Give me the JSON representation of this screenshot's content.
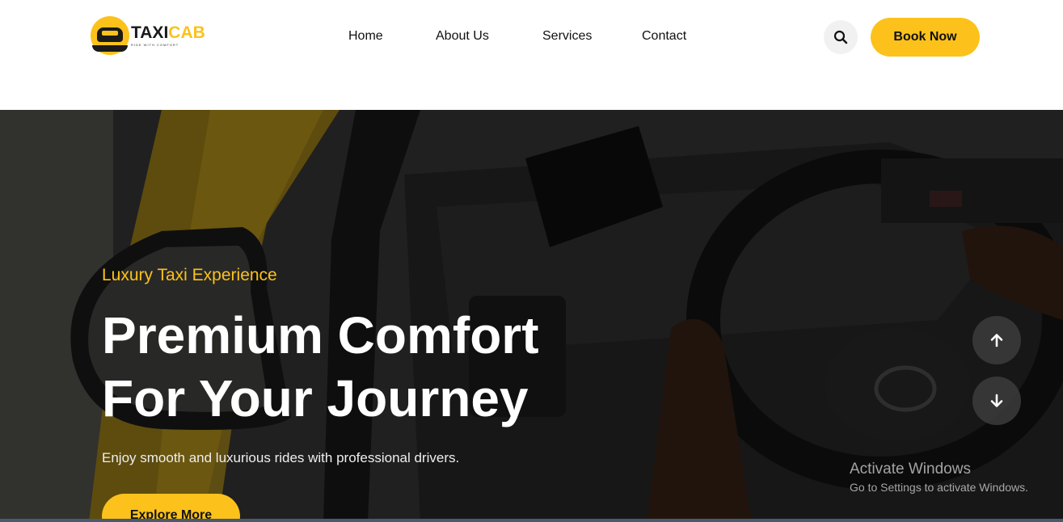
{
  "header": {
    "logo": {
      "taxi": "TAXI",
      "cab": "CAB",
      "tagline": "RIDE WITH COMFORT"
    },
    "nav": [
      {
        "label": "Home"
      },
      {
        "label": "About Us"
      },
      {
        "label": "Services"
      },
      {
        "label": "Contact"
      }
    ],
    "search_icon": "search-icon",
    "book_label": "Book Now"
  },
  "hero": {
    "subtitle": "Luxury Taxi Experience",
    "title_line1": "Premium Comfort",
    "title_line2": "For Your Journey",
    "description": "Enjoy smooth and luxurious rides with professional drivers.",
    "cta_label": "Explore More",
    "nav_up_icon": "arrow-up-icon",
    "nav_down_icon": "arrow-down-icon"
  },
  "watermark": {
    "title": "Activate Windows",
    "subtitle": "Go to Settings to activate Windows."
  },
  "colors": {
    "accent": "#fcc21b",
    "text_dark": "#111111",
    "hero_text": "#ffffff"
  }
}
